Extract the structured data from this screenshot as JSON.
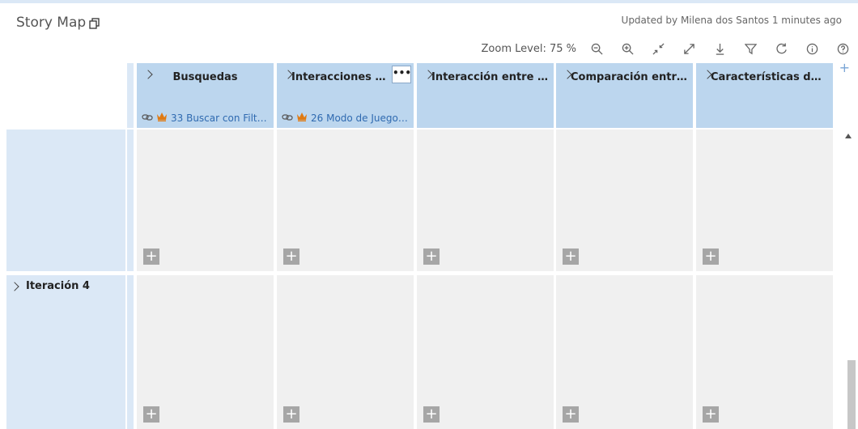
{
  "header": {
    "title": "Story Map",
    "updated": "Updated by Milena dos Santos 1 minutes ago"
  },
  "toolbar": {
    "zoom_label": "Zoom Level: 75 %",
    "icons": [
      "zoom-out-icon",
      "zoom-in-icon",
      "collapse-icon",
      "expand-icon",
      "download-icon",
      "filter-icon",
      "refresh-icon",
      "info-icon",
      "help-icon"
    ]
  },
  "features": [
    {
      "title": "Busquedas",
      "epic": "33 Buscar con Filtros"
    },
    {
      "title": "Interacciones entre",
      "epic": "26 Modo de Juego ..."
    },
    {
      "title": "Interacción entre un..."
    },
    {
      "title": "Comparación entre ..."
    },
    {
      "title": "Características de im..."
    }
  ],
  "iterations": [
    {
      "label": ""
    },
    {
      "label": "Iteración 4"
    }
  ],
  "colors": {
    "feature_bg": "#bcd6ee",
    "lane_bg": "#dbe8f6",
    "cell_bg": "#f0f0f0",
    "epic_icon": "#e07a12",
    "link": "#2f6ab0"
  }
}
